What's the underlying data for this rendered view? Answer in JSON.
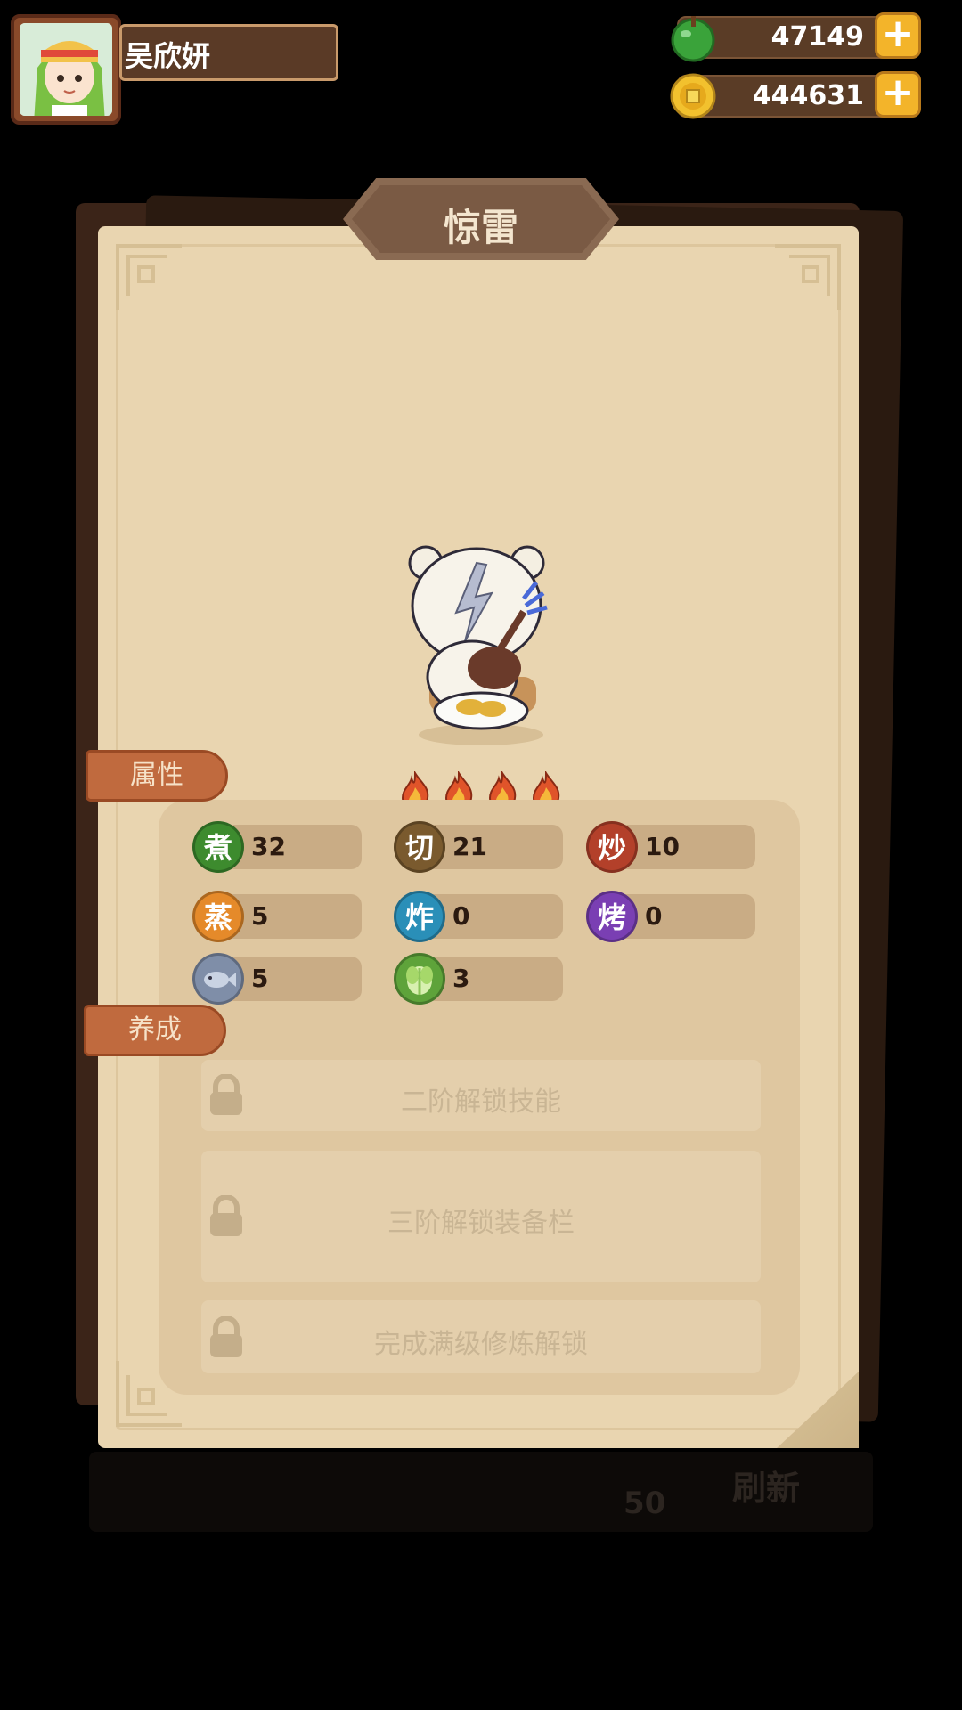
{
  "player": {
    "name": "吴欣妍"
  },
  "resources": [
    {
      "icon": "green-apple-icon",
      "value": "47149"
    },
    {
      "icon": "coin-icon",
      "value": "444631"
    }
  ],
  "panel": {
    "title": "惊雷",
    "stars": 4,
    "tabs": {
      "attributes": "属性",
      "cultivate": "养成"
    },
    "stats": [
      {
        "label": "煮",
        "value": "32",
        "color": "#3d8b2e"
      },
      {
        "label": "切",
        "value": "21",
        "color": "#7a5a2e"
      },
      {
        "label": "炒",
        "value": "10",
        "color": "#b3402a"
      },
      {
        "label": "蒸",
        "value": "5",
        "color": "#e58a2a"
      },
      {
        "label": "炸",
        "value": "0",
        "color": "#2a8fb8"
      },
      {
        "label": "烤",
        "value": "0",
        "color": "#7a3fb3"
      },
      {
        "label": "",
        "value": "5",
        "icon": "fish-icon",
        "color": "#7f8ea8"
      },
      {
        "label": "",
        "value": "3",
        "icon": "cabbage-icon",
        "color": "#5ea33a"
      }
    ],
    "locks": [
      {
        "text": "二阶解锁技能"
      },
      {
        "text": "三阶解锁装备栏"
      },
      {
        "text": "完成满级修炼解锁"
      }
    ]
  },
  "background": {
    "stock_value": "50",
    "refresh_label": "刷新"
  }
}
